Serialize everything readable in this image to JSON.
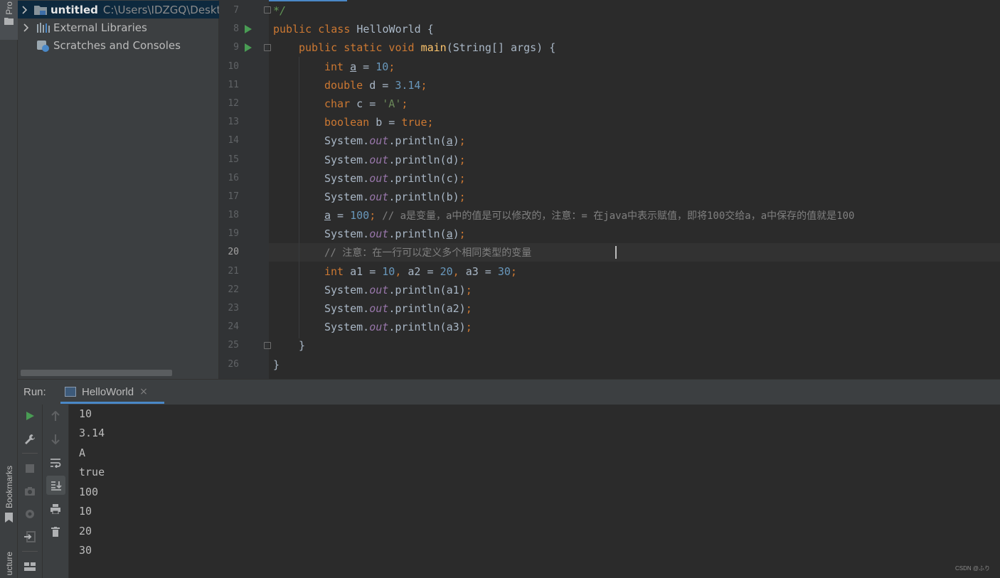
{
  "tool_windows": {
    "project_tab": "Pro",
    "bookmarks_tab": "Bookmarks",
    "structure_tab": "ucture"
  },
  "project_tree": [
    {
      "label": "untitled",
      "path": "C:\\Users\\IDZGQ\\Deskto",
      "icon": "module-folder-icon",
      "expandable": true,
      "selected": true
    },
    {
      "label": "External Libraries",
      "path": "",
      "icon": "libraries-icon",
      "expandable": true,
      "selected": false
    },
    {
      "label": "Scratches and Consoles",
      "path": "",
      "icon": "scratches-icon",
      "expandable": false,
      "selected": false
    }
  ],
  "editor": {
    "current_line": 20,
    "lines": [
      {
        "no": "7"
      },
      {
        "no": "8"
      },
      {
        "no": "9"
      },
      {
        "no": "10"
      },
      {
        "no": "11"
      },
      {
        "no": "12"
      },
      {
        "no": "13"
      },
      {
        "no": "14"
      },
      {
        "no": "15"
      },
      {
        "no": "16"
      },
      {
        "no": "17"
      },
      {
        "no": "18"
      },
      {
        "no": "19"
      },
      {
        "no": "20"
      },
      {
        "no": "21"
      },
      {
        "no": "22"
      },
      {
        "no": "23"
      },
      {
        "no": "24"
      },
      {
        "no": "25"
      },
      {
        "no": "26"
      }
    ],
    "code": {
      "l7": "*/",
      "l8_kw": "public class ",
      "l8_name": "HelloWorld {",
      "l9_kw": "public static void ",
      "l9_method": "main",
      "l9_rest": "(String[] args) {",
      "l10_type": "int ",
      "l10_var": "a",
      "l10_eq": " = ",
      "l10_val": "10",
      "l10_end": ";",
      "l11_type": "double ",
      "l11_rest": "d = ",
      "l11_val": "3.14",
      "l11_end": ";",
      "l12_type": "char ",
      "l12_rest": "c = ",
      "l12_val": "'A'",
      "l12_end": ";",
      "l13_type": "boolean ",
      "l13_rest": "b = ",
      "l13_val": "true",
      "l13_end": ";",
      "sys": "System.",
      "out": "out",
      "println": ".println(",
      "arg_a": "a",
      "arg_d": "d",
      "arg_c": "c",
      "arg_b": "b",
      "close": ")",
      "semi": ";",
      "l18_var": "a",
      "l18_eq": " = ",
      "l18_val": "100",
      "l18_semi": "; ",
      "l18_comment": "// a是变量，a中的值是可以修改的，注意：= 在java中表示赋值，即将100交给a，a中保存的值就是100",
      "l20_comment": "// 注意：在一行可以定义多个相同类型的变量",
      "l21_type": "int ",
      "l21_a1": "a1 = ",
      "l21_v1": "10",
      "l21_c1": ", ",
      "l21_a2": "a2 = ",
      "l21_v2": "20",
      "l21_c2": ", ",
      "l21_a3": "a3 = ",
      "l21_v3": "30",
      "l21_end": ";",
      "arg_a1": "a1",
      "arg_a2": "a2",
      "arg_a3": "a3",
      "l25": "}",
      "l26": "}"
    }
  },
  "run_panel": {
    "label": "Run:",
    "tab_title": "HelloWorld",
    "tab_close": "×",
    "output": [
      "10",
      "3.14",
      "A",
      "true",
      "100",
      "10",
      "20",
      "30"
    ]
  },
  "watermark": "CSDN @ふり",
  "colors": {
    "keyword": "#cc7832",
    "number": "#6897bb",
    "string": "#6a8759",
    "comment": "#808080",
    "method": "#ffc66d",
    "field": "#9876aa",
    "run_green": "#499c54",
    "accent_blue": "#4a88c7"
  }
}
